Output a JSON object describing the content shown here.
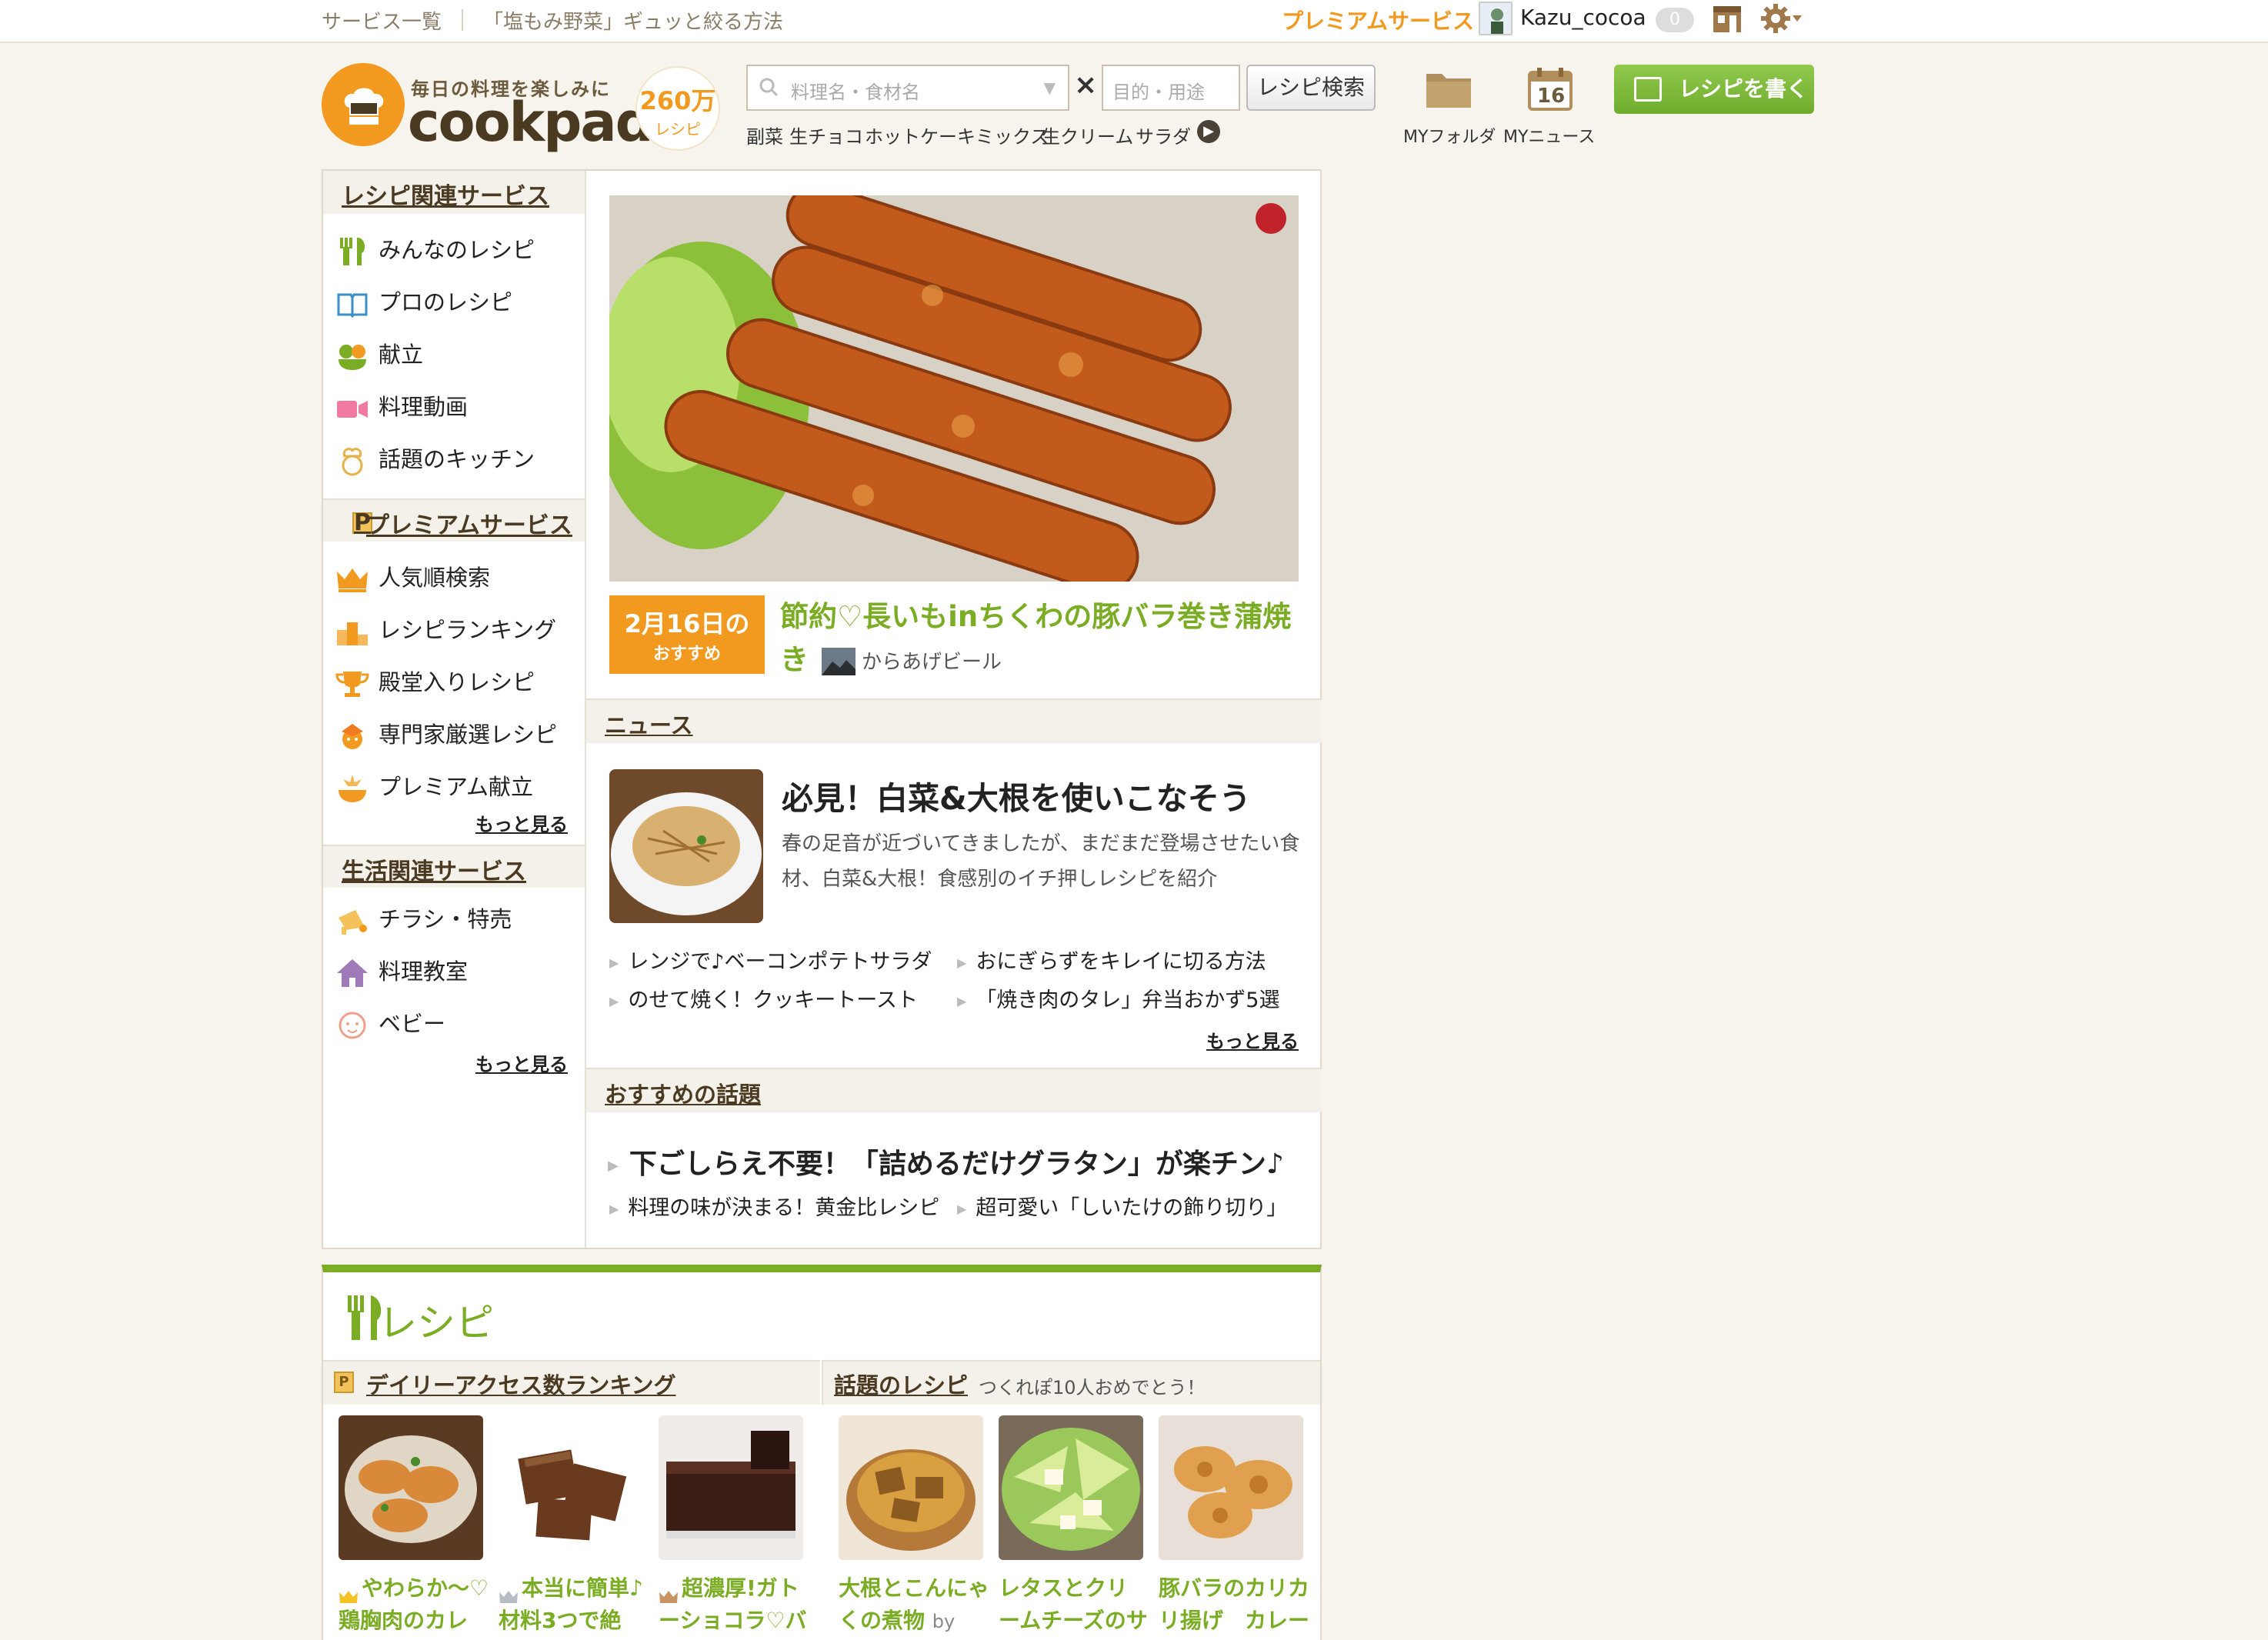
{
  "topbar": {
    "services_link": "サービス一覧",
    "tip_link": "「塩もみ野菜」ギュッと絞る方法",
    "premium": "プレミアムサービス",
    "username": "Kazu_cocoa",
    "notifications": "0"
  },
  "header": {
    "tagline": "毎日の料理を楽しみに",
    "logo": "cookpad",
    "recipe_count": "260万",
    "recipe_count_unit": "レシピ",
    "search_placeholder": "料理名・食材名",
    "clear": "×",
    "purpose_placeholder": "目的・用途",
    "search_button": "レシピ検索",
    "keywords": [
      "副菜",
      "生チョコ",
      "ホットケーキミックス",
      "生クリーム",
      "サラダ"
    ],
    "my_folder": "MYフォルダ",
    "my_news": "MYニュース",
    "calendar_day": "16",
    "write_recipe": "レシピを書く"
  },
  "sidebar": {
    "recipe_services": {
      "heading": "レシピ関連サービス",
      "items": [
        "みんなのレシピ",
        "プロのレシピ",
        "献立",
        "料理動画",
        "話題のキッチン"
      ]
    },
    "premium_services": {
      "heading": "プレミアムサービス",
      "items": [
        "人気順検索",
        "レシピランキング",
        "殿堂入りレシピ",
        "専門家厳選レシピ",
        "プレミアム献立"
      ],
      "more": "もっと見る"
    },
    "life_services": {
      "heading": "生活関連サービス",
      "items": [
        "チラシ・特売",
        "料理教室",
        "ベビー"
      ],
      "more": "もっと見る"
    }
  },
  "featured": {
    "date": "2月16日の",
    "date_sub": "おすすめ",
    "title": "節約♡長いもinちくわの豚バラ巻き蒲焼き",
    "author": "からあげビール"
  },
  "news": {
    "heading": "ニュース",
    "title": "必見！白菜&大根を使いこなそう",
    "desc": "春の足音が近づいてきましたが、まだまだ登場させたい食材、白菜&大根！食感別のイチ押しレシピを紹介",
    "links": [
      "レンジで♪ベーコンポテトサラダ",
      "おにぎらずをキレイに切る方法",
      "のせて焼く！クッキートースト",
      "「焼き肉のタレ」弁当おかず5選"
    ],
    "more": "もっと見る"
  },
  "topics": {
    "heading": "おすすめの話題",
    "main": "下ごしらえ不要！「詰めるだけグラタン」が楽チン♪",
    "links": [
      "料理の味が決まる！黄金比レシピ",
      "超可愛い「しいたけの飾り切り」"
    ]
  },
  "recipe_section": {
    "heading": "レシピ",
    "ranking_heading": "デイリーアクセス数ランキング",
    "ranking": [
      "やわらか〜♡鶏胸肉のカレ",
      "本当に簡単♪材料3つで絶",
      "超濃厚!ガトーショコラ♡バ"
    ],
    "popular_heading": "話題のレシピ",
    "popular_caption": "つくれぽ10人おめでとう！",
    "popular": [
      "大根とこんにゃくの煮物",
      "レタスとクリームチーズのサラ",
      "豚バラのカリカリ揚げ　カレー"
    ],
    "popular_by": "by"
  },
  "colors": {
    "brand_orange": "#f29a1f",
    "brand_green": "#7aac24",
    "background": "#f7f4ee"
  }
}
